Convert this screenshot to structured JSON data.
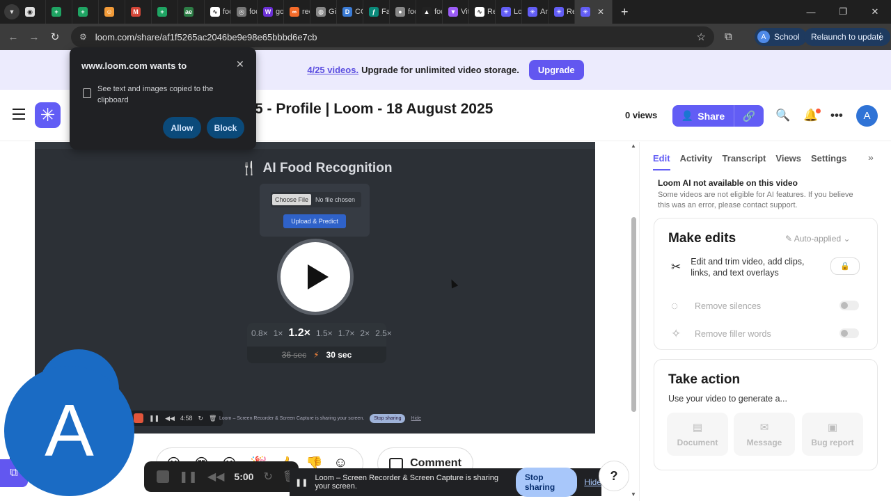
{
  "browser": {
    "tabs": [
      {
        "label": "",
        "color": "#e0e0e0",
        "glyph": "◉"
      },
      {
        "label": "",
        "color": "#1fa463",
        "glyph": "+"
      },
      {
        "label": "",
        "color": "#1fa463",
        "glyph": "+"
      },
      {
        "label": "",
        "color": "#f29b38",
        "glyph": "☺"
      },
      {
        "label": "",
        "color": "#d44638",
        "glyph": "M"
      },
      {
        "label": "",
        "color": "#1fa463",
        "glyph": "+"
      },
      {
        "label": "",
        "color": "#2d7d46",
        "glyph": "ae"
      },
      {
        "label": "foc",
        "color": "#ffffff",
        "glyph": "∿"
      },
      {
        "label": "foc",
        "color": "#777777",
        "glyph": "◎"
      },
      {
        "label": "go",
        "color": "#6b2fd6",
        "glyph": "W"
      },
      {
        "label": "rec",
        "color": "#f46b2a",
        "glyph": "∞"
      },
      {
        "label": "Git",
        "color": "#888888",
        "glyph": "◍"
      },
      {
        "label": "CC",
        "color": "#3a7bd5",
        "glyph": "D"
      },
      {
        "label": "Fa",
        "color": "#0a8a7a",
        "glyph": "ƒ"
      },
      {
        "label": "foc",
        "color": "#888888",
        "glyph": "●"
      },
      {
        "label": "foc",
        "color": "#222222",
        "glyph": "▲"
      },
      {
        "label": "Vit",
        "color": "#9b5cf6",
        "glyph": "▼"
      },
      {
        "label": "Re",
        "color": "#ffffff",
        "glyph": "∿"
      },
      {
        "label": "Lo",
        "color": "#625df5",
        "glyph": "✳"
      },
      {
        "label": "An",
        "color": "#625df5",
        "glyph": "✳"
      },
      {
        "label": "Re",
        "color": "#625df5",
        "glyph": "✳"
      }
    ],
    "active_tab_icon_color": "#625df5",
    "url": "loom.com/share/af1f5265ac2046be9e98e65bbbd6e7cb",
    "profile_label": "School",
    "profile_initial": "A",
    "relaunch_label": "Relaunch to update"
  },
  "permission": {
    "title": "www.loom.com wants to",
    "description": "See text and images copied to the clipboard",
    "allow_label": "Allow",
    "block_label": "Block"
  },
  "banner": {
    "count": "4/25 videos.",
    "text": "Upgrade for unlimited video storage.",
    "button": "Upgrade"
  },
  "header": {
    "title": "5 - Profile | Loom - 18 August 2025",
    "views": "0 views",
    "share_label": "Share",
    "user_initial": "A"
  },
  "video": {
    "app_title": "AI Food Recognition",
    "choose_file": "Choose File",
    "no_file": "No file chosen",
    "predict_label": "Upload & Predict",
    "speeds": [
      "0.8×",
      "1×",
      "1.2×",
      "1.5×",
      "1.7×",
      "2×",
      "2.5×"
    ],
    "selected_speed": "1.2×",
    "original_duration": "36 sec",
    "new_duration": "30 sec",
    "mini_time": "4:58",
    "mini_share_text": "Loom – Screen Recorder & Screen Capture is sharing your screen.",
    "mini_stop": "Stop sharing",
    "mini_hide": "Hide"
  },
  "camera": {
    "initial": "A"
  },
  "comment_label": "Comment",
  "recorder": {
    "time": "5:00",
    "share_text": "Loom – Screen Recorder & Screen Capture is sharing your screen.",
    "stop_label": "Stop sharing",
    "hide_label": "Hide"
  },
  "help_label": "?",
  "sidebar": {
    "tabs": [
      "Edit",
      "Activity",
      "Transcript",
      "Views",
      "Settings"
    ],
    "ai_title": "Loom AI not available on this video",
    "ai_desc": "Some videos are not eligible for AI features. If you believe this was an error, please contact support.",
    "edits_title": "Make edits",
    "auto_applied": "Auto-applied",
    "edit_items": [
      "Edit and trim video, add clips, links, and text overlays",
      "Remove silences",
      "Remove filler words"
    ],
    "action_title": "Take action",
    "action_sub": "Use your video to generate a...",
    "action_tiles": [
      "Document",
      "Message",
      "Bug report"
    ]
  }
}
